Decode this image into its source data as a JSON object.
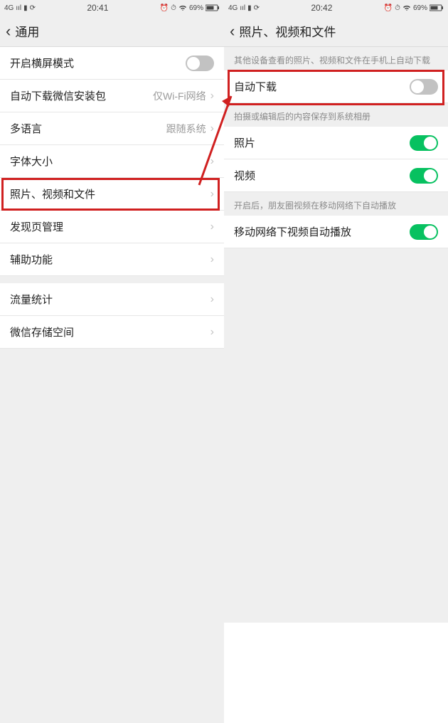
{
  "left": {
    "status": {
      "net": "4G",
      "time": "20:41",
      "battery": "69%"
    },
    "nav": {
      "title": "通用"
    },
    "rows": {
      "landscape": {
        "label": "开启横屏模式"
      },
      "autodl_wechat": {
        "label": "自动下载微信安装包",
        "value": "仅Wi-Fi网络"
      },
      "language": {
        "label": "多语言",
        "value": "跟随系统"
      },
      "fontsize": {
        "label": "字体大小"
      },
      "media": {
        "label": "照片、视频和文件"
      },
      "discover": {
        "label": "发现页管理"
      },
      "accessibility": {
        "label": "辅助功能"
      },
      "traffic": {
        "label": "流量统计"
      },
      "storage": {
        "label": "微信存储空间"
      }
    }
  },
  "right": {
    "status": {
      "net": "4G",
      "time": "20:42",
      "battery": "69%"
    },
    "nav": {
      "title": "照片、视频和文件"
    },
    "sections": {
      "s1": "其他设备查看的照片、视频和文件在手机上自动下载",
      "s2": "拍摄或编辑后的内容保存到系统相册",
      "s3": "开启后，朋友圈视频在移动网络下自动播放"
    },
    "rows": {
      "autodl": {
        "label": "自动下载"
      },
      "photo": {
        "label": "照片"
      },
      "video": {
        "label": "视频"
      },
      "mobileplay": {
        "label": "移动网络下视频自动播放"
      }
    }
  }
}
